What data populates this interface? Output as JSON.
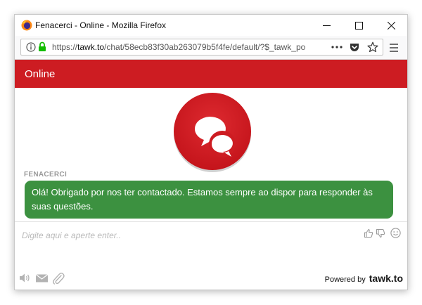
{
  "window": {
    "title": "Fenacerci - Online - Mozilla Firefox"
  },
  "browser": {
    "url_prefix": "https://",
    "url_domain": "tawk.to",
    "url_path": "/chat/58ecb83f30ab263079b5f4fe/default/?$_tawk_po",
    "page_actions_icon": "ellipsis-icon",
    "pocket_icon": "pocket-icon",
    "bookmark_icon": "star-icon",
    "menu_icon": "hamburger-icon"
  },
  "chat": {
    "header_title": "Online",
    "header_color": "#cd1c22",
    "agent_name": "FENACERCI",
    "message": "Olá! Obrigado por nos ter contactado. Estamos sempre ao dispor para responder às suas questões.",
    "bubble_color": "#3c9140",
    "input_placeholder": "Digite aqui e aperte enter..",
    "powered_by_label": "Powered by",
    "brand": "tawk.to"
  }
}
